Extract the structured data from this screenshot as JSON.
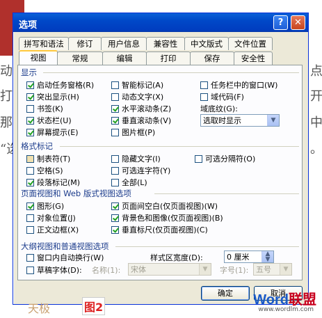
{
  "background": {
    "fragments": [
      "动这",
      "打开",
      "那么",
      "“选"
    ],
    "fragments_right": [
      "点",
      "开",
      "中",
      "。"
    ],
    "watermark_left": "天极",
    "figure_label": "图2",
    "watermark_brand_a": "Word",
    "watermark_brand_b": "联盟",
    "watermark_url": "www.wordlm.com"
  },
  "dialog": {
    "title": "选项",
    "help_glyph": "?",
    "close_glyph": "✕",
    "tabs_row1": [
      "拼写和语法",
      "修订",
      "用户信息",
      "兼容性",
      "中文版式",
      "文件位置"
    ],
    "tabs_row2": [
      "视图",
      "常规",
      "编辑",
      "打印",
      "保存",
      "安全性"
    ],
    "active_tab": "视图",
    "sections": {
      "display": {
        "label": "显示",
        "col1": [
          {
            "label": "启动任务窗格(R)",
            "checked": true
          },
          {
            "label": "突出显示(H)",
            "checked": true
          },
          {
            "label": "书签(K)",
            "checked": false
          },
          {
            "label": "状态栏(U)",
            "checked": true
          },
          {
            "label": "屏幕提示(E)",
            "checked": true
          }
        ],
        "col2": [
          {
            "label": "智能标记(A)",
            "checked": false
          },
          {
            "label": "动态文字(X)",
            "checked": false
          },
          {
            "label": "水平滚动条(Z)",
            "checked": true
          },
          {
            "label": "垂直滚动条(V)",
            "checked": true
          },
          {
            "label": "图片框(P)",
            "checked": false
          }
        ],
        "col3": [
          {
            "label": "任务栏中的窗口(W)",
            "checked": false
          },
          {
            "label": "域代码(F)",
            "checked": false
          }
        ],
        "field_shading_label": "域底纹(G):",
        "field_shading_value": "选取时显示"
      },
      "format_marks": {
        "label": "格式标记",
        "col1": [
          {
            "label": "制表符(T)",
            "checked": false
          },
          {
            "label": "空格(S)",
            "checked": false
          },
          {
            "label": "段落标记(M)",
            "checked": true
          }
        ],
        "col2": [
          {
            "label": "隐藏文字(I)",
            "checked": false
          },
          {
            "label": "可选连字符(Y)",
            "checked": false
          },
          {
            "label": "全部(L)",
            "checked": false
          }
        ],
        "col3": [
          {
            "label": "可选分隔符(O)",
            "checked": false
          }
        ]
      },
      "print_web": {
        "label": "页面视图和 Web 版式视图选项",
        "col1": [
          {
            "label": "图形(G)",
            "checked": true
          },
          {
            "label": "对象位置(J)",
            "checked": false
          },
          {
            "label": "正文边框(X)",
            "checked": false
          }
        ],
        "col2": [
          {
            "label": "页面间空白(仅页面视图)(W)",
            "checked": true
          },
          {
            "label": "背景色和图像(仅页面视图)(B)",
            "checked": true
          },
          {
            "label": "垂直标尺(仅页面视图)(C)",
            "checked": true
          }
        ]
      },
      "outline": {
        "label": "大纲视图和普通视图选项",
        "wrap_label": "窗口内自动换行(W)",
        "wrap_checked": false,
        "style_width_label": "样式区宽度(D):",
        "style_width_value": "0 厘米",
        "draft_label": "草稿字体(D):",
        "draft_checked": false,
        "name_label": "名称(1):",
        "name_value": "宋体",
        "size_label": "字号(1):",
        "size_value": "五号"
      }
    },
    "ok_label": "确定",
    "cancel_label": "取消"
  }
}
